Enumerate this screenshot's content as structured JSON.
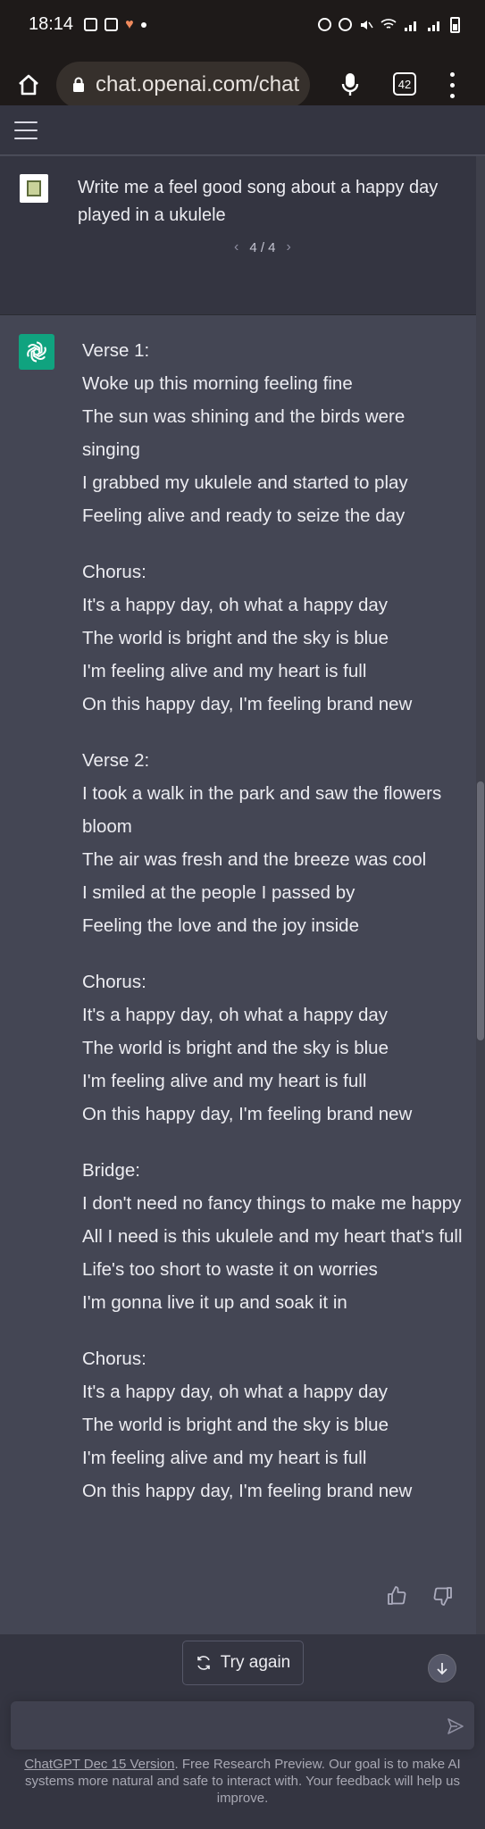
{
  "status_bar": {
    "time": "18:14"
  },
  "browser": {
    "url": "chat.openai.com/chat",
    "tab_count": "42"
  },
  "conversation": {
    "user_message": "Write me a feel good song about a happy day played in a ukulele",
    "pager": "4 / 4",
    "assistant_stanzas": [
      [
        "Verse 1:",
        "Woke up this morning feeling fine",
        "The sun was shining and the birds were singing",
        "I grabbed my ukulele and started to play",
        "Feeling alive and ready to seize the day"
      ],
      [
        "Chorus:",
        "It's a happy day, oh what a happy day",
        "The world is bright and the sky is blue",
        "I'm feeling alive and my heart is full",
        "On this happy day, I'm feeling brand new"
      ],
      [
        "Verse 2:",
        "I took a walk in the park and saw the flowers bloom",
        "The air was fresh and the breeze was cool",
        "I smiled at the people I passed by",
        "Feeling the love and the joy inside"
      ],
      [
        "Chorus:",
        "It's a happy day, oh what a happy day",
        "The world is bright and the sky is blue",
        "I'm feeling alive and my heart is full",
        "On this happy day, I'm feeling brand new"
      ],
      [
        "Bridge:",
        "I don't need no fancy things to make me happy",
        "All I need is this ukulele and my heart that's full",
        "Life's too short to waste it on worries",
        "I'm gonna live it up and soak it in"
      ],
      [
        "Chorus:",
        "It's a happy day, oh what a happy day",
        "The world is bright and the sky is blue",
        "I'm feeling alive and my heart is full",
        "On this happy day, I'm feeling brand new"
      ]
    ]
  },
  "controls": {
    "try_again_label": "Try again",
    "input_placeholder": ""
  },
  "footer": {
    "link_text": "ChatGPT Dec 15 Version",
    "text": ". Free Research Preview. Our goal is to make AI systems more natural and safe to interact with. Your feedback will help us improve."
  },
  "colors": {
    "assistant_bg": "#444654",
    "user_bg": "#343541",
    "brand_green": "#10a37f"
  },
  "icons": [
    "home-icon",
    "lock-icon",
    "mic-icon",
    "tabs-icon",
    "more-vert-icon",
    "hamburger-icon",
    "chevron-left-icon",
    "chevron-right-icon",
    "openai-logo-icon",
    "thumbs-up-icon",
    "thumbs-down-icon",
    "refresh-icon",
    "arrow-down-icon",
    "send-icon"
  ]
}
